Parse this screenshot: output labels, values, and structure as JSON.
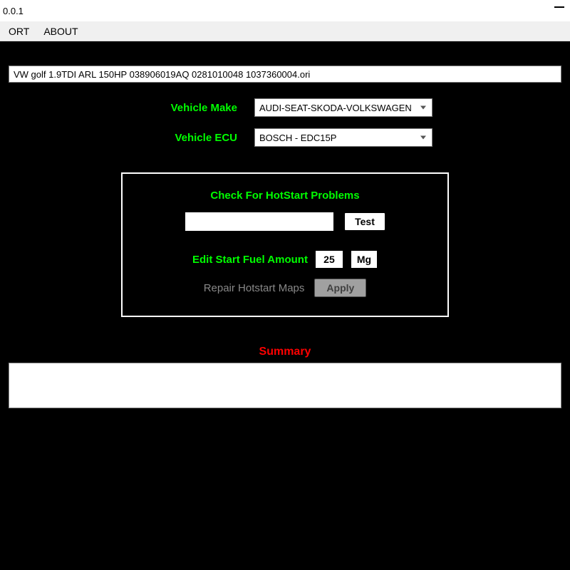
{
  "titlebar": {
    "version": "0.0.1"
  },
  "menu": {
    "item0": "ORT",
    "item1": "ABOUT"
  },
  "file": {
    "value": "VW golf 1.9TDI ARL 150HP 038906019AQ 0281010048 1037360004.ori"
  },
  "labels": {
    "make": "Vehicle Make",
    "ecu": "Vehicle ECU"
  },
  "make": {
    "selected": "AUDI-SEAT-SKODA-VOLKSWAGEN"
  },
  "ecu": {
    "selected": "BOSCH - EDC15P"
  },
  "panel": {
    "title": "Check For HotStart Problems",
    "test_btn": "Test",
    "fuel_label": "Edit Start Fuel Amount",
    "fuel_value": "25",
    "fuel_unit": "Mg",
    "repair_label": "Repair Hotstart Maps",
    "apply_btn": "Apply"
  },
  "summary": {
    "title": "Summary"
  }
}
